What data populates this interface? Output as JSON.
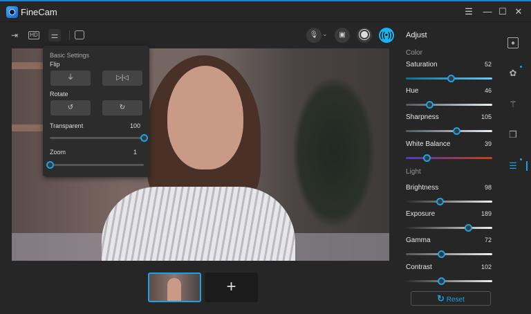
{
  "app": {
    "title": "FineCam"
  },
  "window": {
    "menu_icon": "☰",
    "minimize_icon": "—",
    "maximize_icon": "☐",
    "close_icon": "✕"
  },
  "toolbar": {
    "hd_label": "HD"
  },
  "basic_settings": {
    "title": "Basic Settings",
    "flip_label": "Flip",
    "rotate_label": "Rotate",
    "transparent_label": "Transparent",
    "transparent_value": "100",
    "transparent_fraction": 1.0,
    "zoom_label": "Zoom",
    "zoom_value": "1",
    "zoom_fraction": 0.0
  },
  "thumbnails": {
    "add_label": "+"
  },
  "adjust": {
    "title": "Adjust",
    "color_section": "Color",
    "light_section": "Light",
    "reset_label": "Reset",
    "sliders": [
      {
        "label": "Saturation",
        "value": "52",
        "fraction": 0.52
      },
      {
        "label": "Hue",
        "value": "46",
        "fraction": 0.27
      },
      {
        "label": "Sharpness",
        "value": "105",
        "fraction": 0.58
      },
      {
        "label": "White Balance",
        "value": "39",
        "fraction": 0.24
      },
      {
        "label": "Brightness",
        "value": "98",
        "fraction": 0.39
      },
      {
        "label": "Exposure",
        "value": "189",
        "fraction": 0.72
      },
      {
        "label": "Gamma",
        "value": "72",
        "fraction": 0.41
      },
      {
        "label": "Contrast",
        "value": "102",
        "fraction": 0.41
      }
    ]
  },
  "colors": {
    "accent": "#1aa3e8",
    "live": "#19b4f0"
  }
}
